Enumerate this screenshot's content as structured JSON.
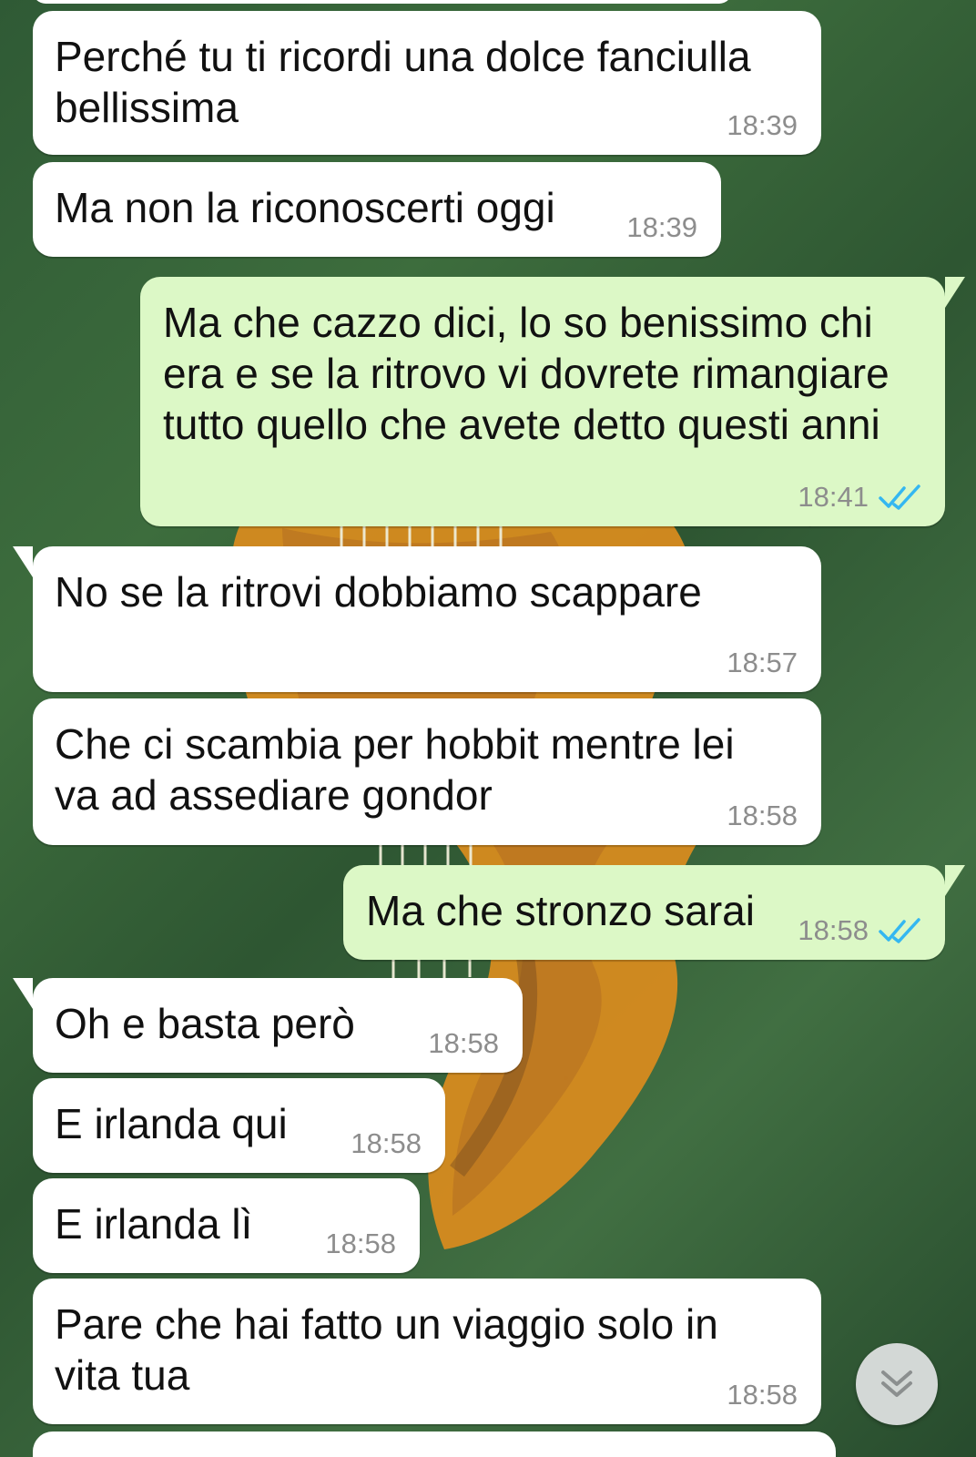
{
  "background": {
    "primary_color": "#33593a",
    "accent_color": "#d58b1f"
  },
  "messages": [
    {
      "direction": "incoming",
      "text": "Perché tu ti ricordi una dolce fanciulla\nbellissima",
      "time": "18:39"
    },
    {
      "direction": "incoming",
      "text": "Ma non la riconoscerti oggi",
      "time": "18:39"
    },
    {
      "direction": "outgoing",
      "text": "Ma che cazzo dici, lo so benissimo chi\nera e  se la ritrovo vi dovrete rimangiare\ntutto quello che avete detto questi anni",
      "time": "18:41",
      "status_icon": "double-check-read-icon"
    },
    {
      "direction": "incoming",
      "text": "No se la ritrovi dobbiamo scappare",
      "time": "18:57"
    },
    {
      "direction": "incoming",
      "text": "Che ci scambia per hobbit mentre lei\nva ad assediare gondor",
      "time": "18:58"
    },
    {
      "direction": "outgoing",
      "text": "Ma che stronzo sarai",
      "time": "18:58",
      "status_icon": "double-check-read-icon"
    },
    {
      "direction": "incoming",
      "text": "Oh e basta però",
      "time": "18:58"
    },
    {
      "direction": "incoming",
      "text": "E irlanda qui",
      "time": "18:58"
    },
    {
      "direction": "incoming",
      "text": "E irlanda lì",
      "time": "18:58"
    },
    {
      "direction": "incoming",
      "text": "Pare che hai fatto un viaggio solo in\nvita tua",
      "time": "18:58"
    }
  ],
  "controls": {
    "scroll_to_bottom_icon": "double-chevron-down-icon"
  }
}
